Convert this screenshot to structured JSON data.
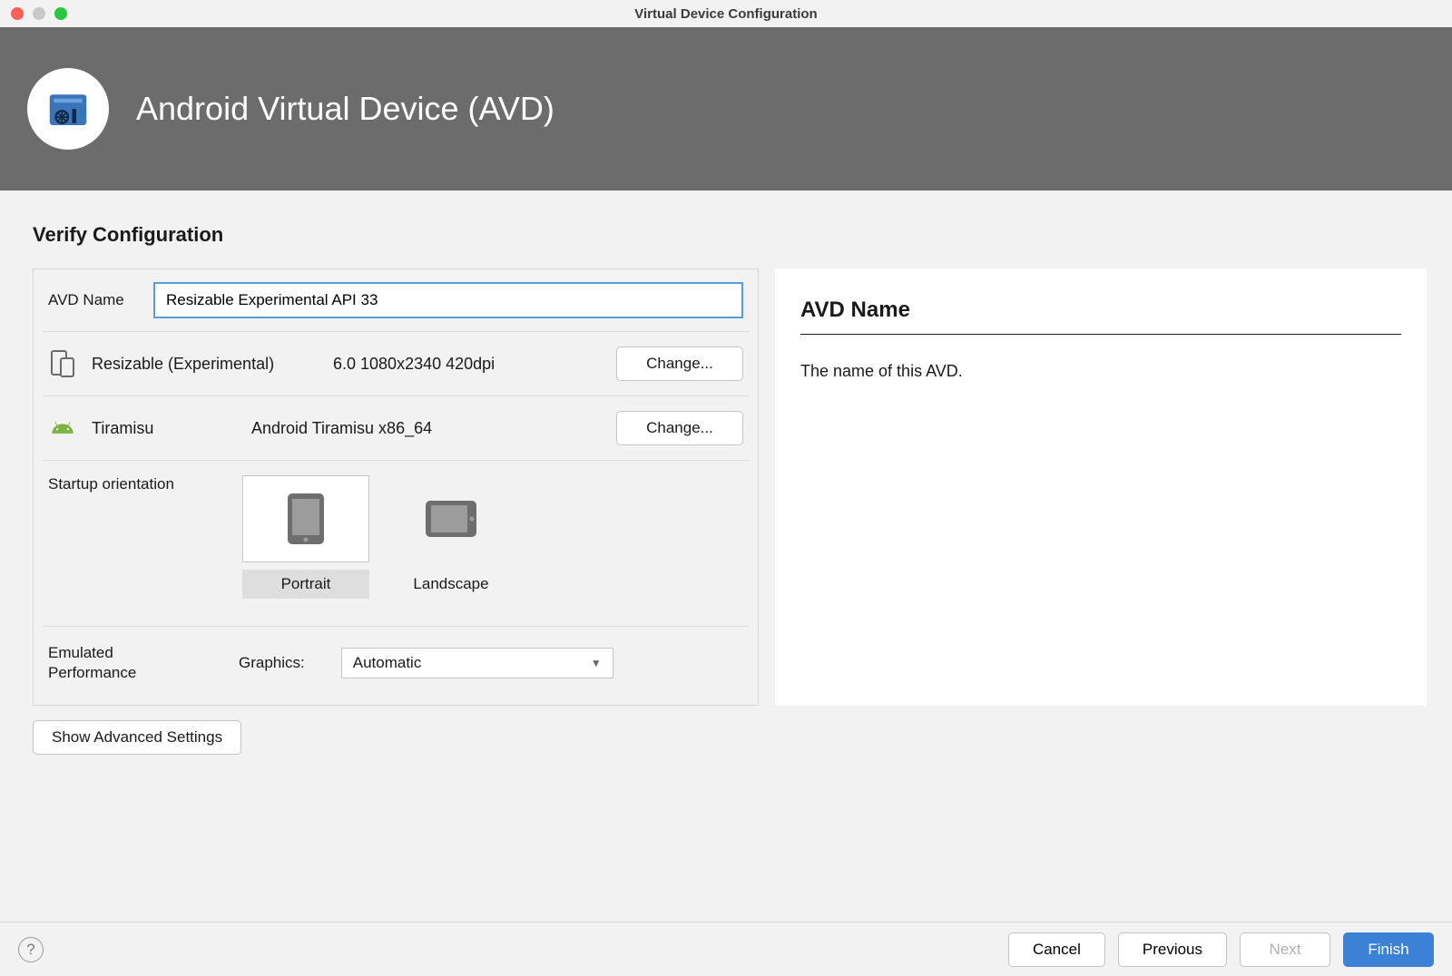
{
  "window": {
    "title": "Virtual Device Configuration"
  },
  "header": {
    "title": "Android Virtual Device (AVD)"
  },
  "section_title": "Verify Configuration",
  "form": {
    "avd_name_label": "AVD Name",
    "avd_name_value": "Resizable Experimental API 33",
    "device_name": "Resizable (Experimental)",
    "device_spec": "6.0 1080x2340 420dpi",
    "device_change": "Change...",
    "sysimg_name": "Tiramisu",
    "sysimg_spec": "Android Tiramisu x86_64",
    "sysimg_change": "Change...",
    "orientation_label": "Startup orientation",
    "orientation_portrait": "Portrait",
    "orientation_landscape": "Landscape",
    "perf_label": "Emulated\nPerformance",
    "graphics_label": "Graphics:",
    "graphics_value": "Automatic",
    "show_advanced": "Show Advanced Settings"
  },
  "help_panel": {
    "title": "AVD Name",
    "description": "The name of this AVD."
  },
  "footer": {
    "cancel": "Cancel",
    "previous": "Previous",
    "next": "Next",
    "finish": "Finish"
  }
}
